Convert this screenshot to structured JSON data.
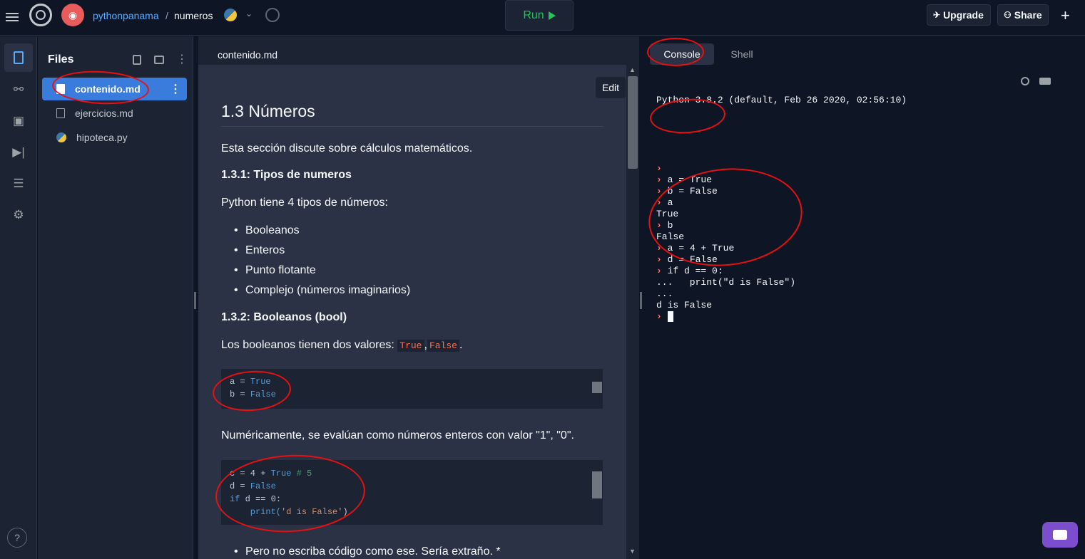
{
  "topbar": {
    "owner": "pythonpanama",
    "separator": "/",
    "repl_name": "numeros",
    "run_label": "Run",
    "run_icon": "play-icon",
    "upgrade_label": "Upgrade",
    "share_label": "Share",
    "plus": "+"
  },
  "files": {
    "title": "Files",
    "items": [
      {
        "name": "contenido.md",
        "icon": "file-icon",
        "active": true
      },
      {
        "name": "ejercicios.md",
        "icon": "file-icon",
        "active": false
      },
      {
        "name": "hipoteca.py",
        "icon": "python-icon",
        "active": false
      }
    ]
  },
  "editor": {
    "tab": "contenido.md",
    "edit_label": "Edit",
    "heading": "1.3 Números",
    "p1": "Esta sección discute sobre cálculos matemáticos.",
    "h_tipos": "1.3.1: Tipos de numeros",
    "p2": "Python tiene 4 tipos de números:",
    "list": [
      "Booleanos",
      "Enteros",
      "Punto flotante",
      "Complejo (números imaginarios)"
    ],
    "h_bool": "1.3.2: Booleanos (bool)",
    "p3_pre": "Los booleanos tienen dos valores: ",
    "true_code": "True",
    "comma": ",",
    "false_code": "False",
    "period": ".",
    "code1": {
      "l1_a": "a = ",
      "l1_b": "True",
      "l2_a": "b = ",
      "l2_b": "False"
    },
    "p4": "Numéricamente, se evalúan como números enteros con valor \"1\", \"0\".",
    "code2": {
      "l1_a": "c = 4 + ",
      "l1_b": "True",
      "l1_c": " # 5",
      "l2_a": "d = ",
      "l2_b": "False",
      "l3_a": "if",
      "l3_b": " d == 0:",
      "l4_a": "    print(",
      "l4_b": "'d is False'",
      "l4_c": ")"
    },
    "bullet_last": "Pero no escriba código como ese. Sería extraño. *"
  },
  "console": {
    "tabs": [
      "Console",
      "Shell"
    ],
    "header": "Python 3.8.2 (default, Feb 26 2020, 02:56:10)",
    "prompt_symbol": "›",
    "lines": [
      {
        "prompt": true,
        "text": ""
      },
      {
        "prompt": true,
        "text": "a = True"
      },
      {
        "prompt": true,
        "text": "b = False"
      },
      {
        "prompt": true,
        "text": "a"
      },
      {
        "prompt": false,
        "text": "True"
      },
      {
        "prompt": true,
        "text": "b"
      },
      {
        "prompt": false,
        "text": "False"
      },
      {
        "prompt": true,
        "text": "a = 4 + True"
      },
      {
        "prompt": true,
        "text": "d = False"
      },
      {
        "prompt": true,
        "text": "if d == 0:"
      },
      {
        "prompt": false,
        "text": "...   print(\"d is False\")"
      },
      {
        "prompt": false,
        "text": "..."
      },
      {
        "prompt": false,
        "text": "d is False"
      }
    ]
  },
  "help": "?",
  "colors": {
    "accent": "#3a7cdb",
    "run_green": "#21c35a",
    "prompt_orange": "#ff6e52",
    "annotation_red": "#e81010"
  }
}
